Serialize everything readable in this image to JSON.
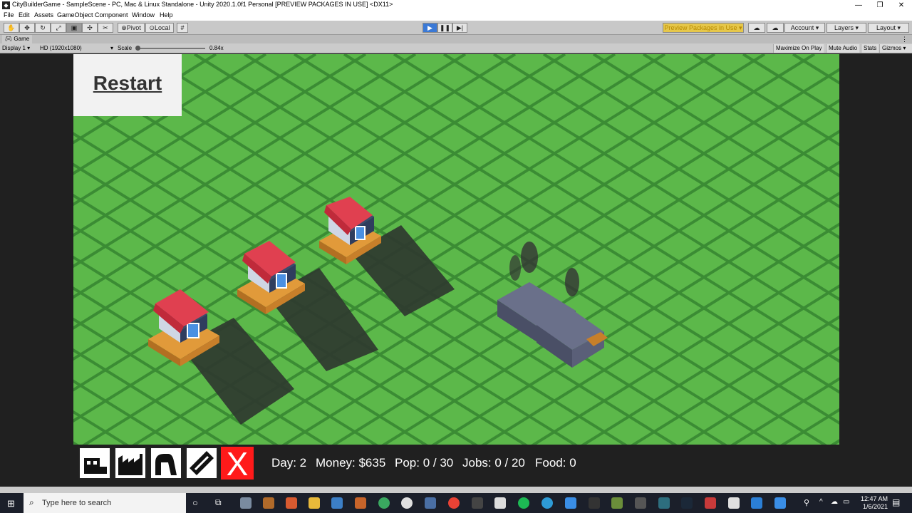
{
  "window": {
    "title": "CityBuilderGame - SampleScene - PC, Mac & Linux Standalone - Unity 2020.1.0f1 Personal [PREVIEW PACKAGES IN USE] <DX11>"
  },
  "menu": [
    "File",
    "Edit",
    "Assets",
    "GameObject",
    "Component",
    "Window",
    "Help"
  ],
  "toolbar": {
    "pivot_label": "Pivot",
    "local_label": "Local",
    "preview_packages_label": "Preview Packages in Use",
    "account_label": "Account",
    "layers_label": "Layers",
    "layout_label": "Layout"
  },
  "game_tab": {
    "label": "Game"
  },
  "game_bar": {
    "display": "Display 1",
    "resolution": "HD (1920x1080)",
    "scale_label": "Scale",
    "scale_value": "0.84x",
    "maximize_on_play": "Maximize On Play",
    "mute_audio": "Mute Audio",
    "stats": "Stats",
    "gizmos": "Gizmos"
  },
  "game": {
    "restart_label": "Restart",
    "stats": {
      "day": "Day: 2",
      "money": "Money: $635",
      "pop": "Pop: 0 / 30",
      "jobs": "Jobs: 0 / 20",
      "food": "Food: 0"
    },
    "build_buttons": [
      "house-tool",
      "factory-tool",
      "farm-tool",
      "road-tool",
      "demolish-tool"
    ],
    "demolish_label": "X"
  },
  "taskbar": {
    "search_placeholder": "Type here to search",
    "time": "12:47 AM",
    "date": "1/6/2021"
  },
  "colors": {
    "grass": "#5cb84a",
    "grid_line": "#3b8c34",
    "road": "#2f3a2f",
    "roof": "#e04050",
    "factory": "#5a5f78",
    "demolish": "#ff1a1a",
    "play_button": "#3a79d6"
  }
}
